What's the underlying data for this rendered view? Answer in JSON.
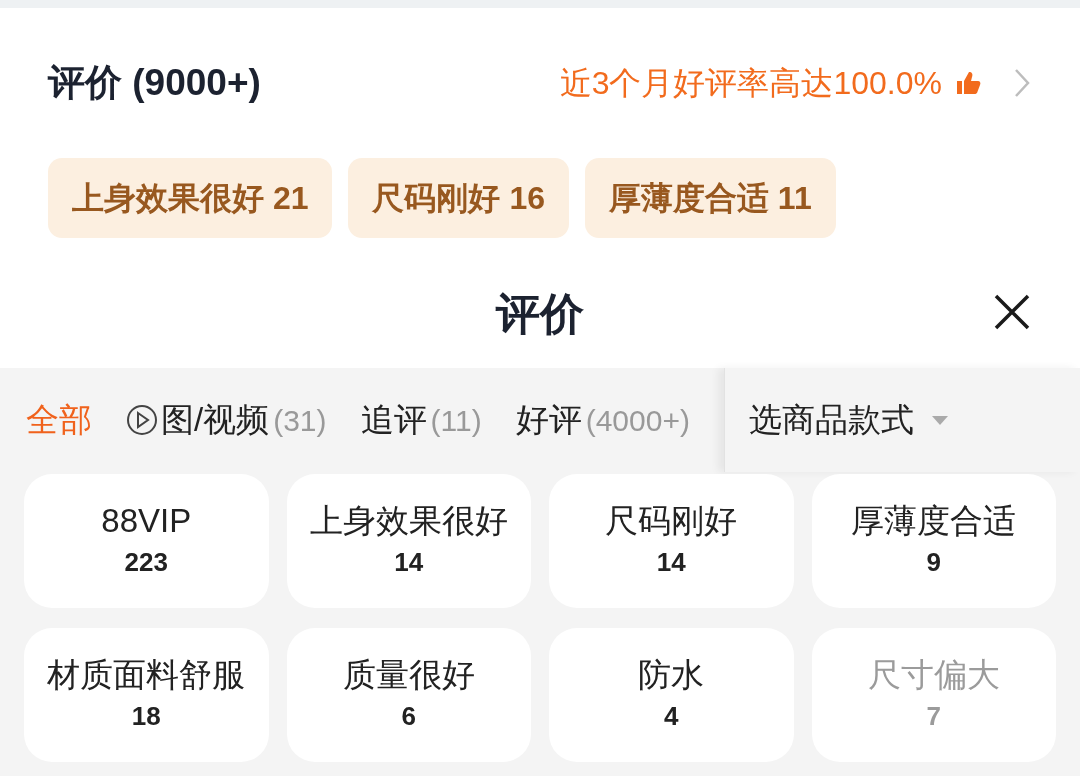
{
  "summary": {
    "title": "评价 (9000+)",
    "rating_text": "近3个月好评率高达100.0%"
  },
  "highlight_tags": [
    {
      "label": "上身效果很好 21"
    },
    {
      "label": "尺码刚好 16"
    },
    {
      "label": "厚薄度合适 11"
    }
  ],
  "sheet": {
    "title": "评价"
  },
  "filters": [
    {
      "kind": "plain",
      "label": "全部",
      "selected": true
    },
    {
      "kind": "media",
      "label": "图/视频",
      "count": "(31)",
      "selected": false
    },
    {
      "kind": "plain",
      "label": "追评",
      "count": "(11)",
      "selected": false
    },
    {
      "kind": "plain",
      "label": "好评",
      "count": "(4000+)",
      "selected": false
    }
  ],
  "style_selector": {
    "label": "选商品款式"
  },
  "tags": [
    {
      "label": "88VIP",
      "count": "223",
      "muted": false
    },
    {
      "label": "上身效果很好",
      "count": "14",
      "muted": false
    },
    {
      "label": "尺码刚好",
      "count": "14",
      "muted": false
    },
    {
      "label": "厚薄度合适",
      "count": "9",
      "muted": false
    },
    {
      "label": "材质面料舒服",
      "count": "18",
      "muted": false
    },
    {
      "label": "质量很好",
      "count": "6",
      "muted": false
    },
    {
      "label": "防水",
      "count": "4",
      "muted": false
    },
    {
      "label": "尺寸偏大",
      "count": "7",
      "muted": true
    }
  ]
}
